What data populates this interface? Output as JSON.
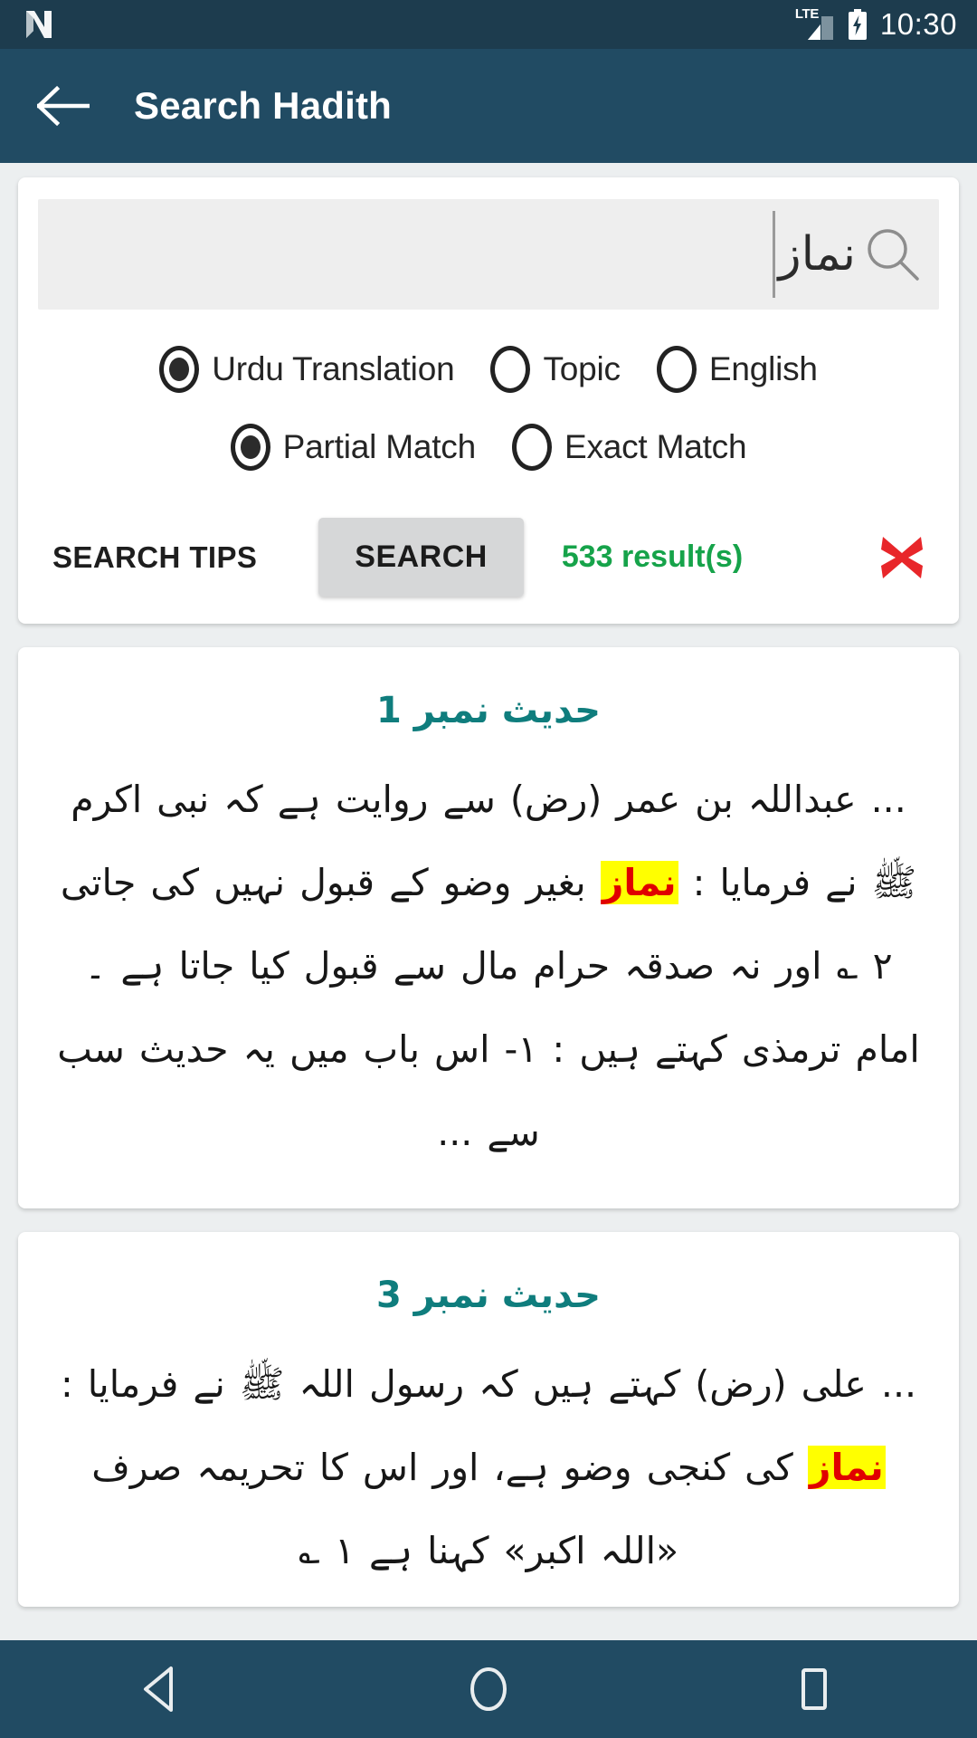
{
  "status_bar": {
    "app_icon": "n-logo-icon",
    "network_type": "LTE",
    "signal_icon": "signal-bars-icon",
    "battery_icon": "battery-charging-icon",
    "time": "10:30"
  },
  "app_bar": {
    "back_icon": "arrow-left-icon",
    "title": "Search Hadith"
  },
  "search": {
    "query": "نماز",
    "placeholder": "",
    "search_icon": "magnifier-icon",
    "scope_options": [
      {
        "label": "Urdu Translation",
        "selected": true
      },
      {
        "label": "Topic",
        "selected": false
      },
      {
        "label": "English",
        "selected": false
      }
    ],
    "match_options": [
      {
        "label": "Partial Match",
        "selected": true
      },
      {
        "label": "Exact Match",
        "selected": false
      }
    ],
    "tips_label": "SEARCH TIPS",
    "search_label": "SEARCH",
    "result_count_label": "533 result(s)",
    "clear_icon": "red-cross-icon",
    "result_color": "#16a34a",
    "clear_color": "#e8262a"
  },
  "results": [
    {
      "title": "حدیث نمبر 1",
      "segments": [
        {
          "text": "... عبداللہ بن عمر (رض) سے روایت ہے کہ نبی اکرم ﷺ نے فرمایا : ",
          "highlight": false
        },
        {
          "text": "نماز",
          "highlight": true
        },
        {
          "text": " بغیر وضو کے قبول نہیں کی جاتی ٢ ؎ اور نہ صدقہ حرام مال سے قبول کیا جاتا ہے ۔ امام ترمذی کہتے ہیں : ١- اس باب میں یہ حدیث سب سے ...",
          "highlight": false
        }
      ]
    },
    {
      "title": "حدیث نمبر 3",
      "segments": [
        {
          "text": "... علی (رض) کہتے ہیں کہ رسول اللہ ﷺ نے فرمایا : ",
          "highlight": false
        },
        {
          "text": "نماز",
          "highlight": true
        },
        {
          "text": " کی کنجی وضو ہے، اور اس کا تحریمہ صرف «اللہ اکبر» کہنا ہے ١ ؎",
          "highlight": false
        }
      ]
    }
  ],
  "nav_bar": {
    "back_icon": "triangle-back-icon",
    "home_icon": "circle-home-icon",
    "recents_icon": "square-recents-icon"
  },
  "theme": {
    "status_bar_bg": "#1d3c4e",
    "app_bar_bg": "#214b63",
    "page_bg": "#eceff0",
    "card_bg": "#ffffff",
    "hadith_title_color": "#0f7d7d",
    "highlight_bg": "#ffff00",
    "highlight_text": "#e00000"
  }
}
